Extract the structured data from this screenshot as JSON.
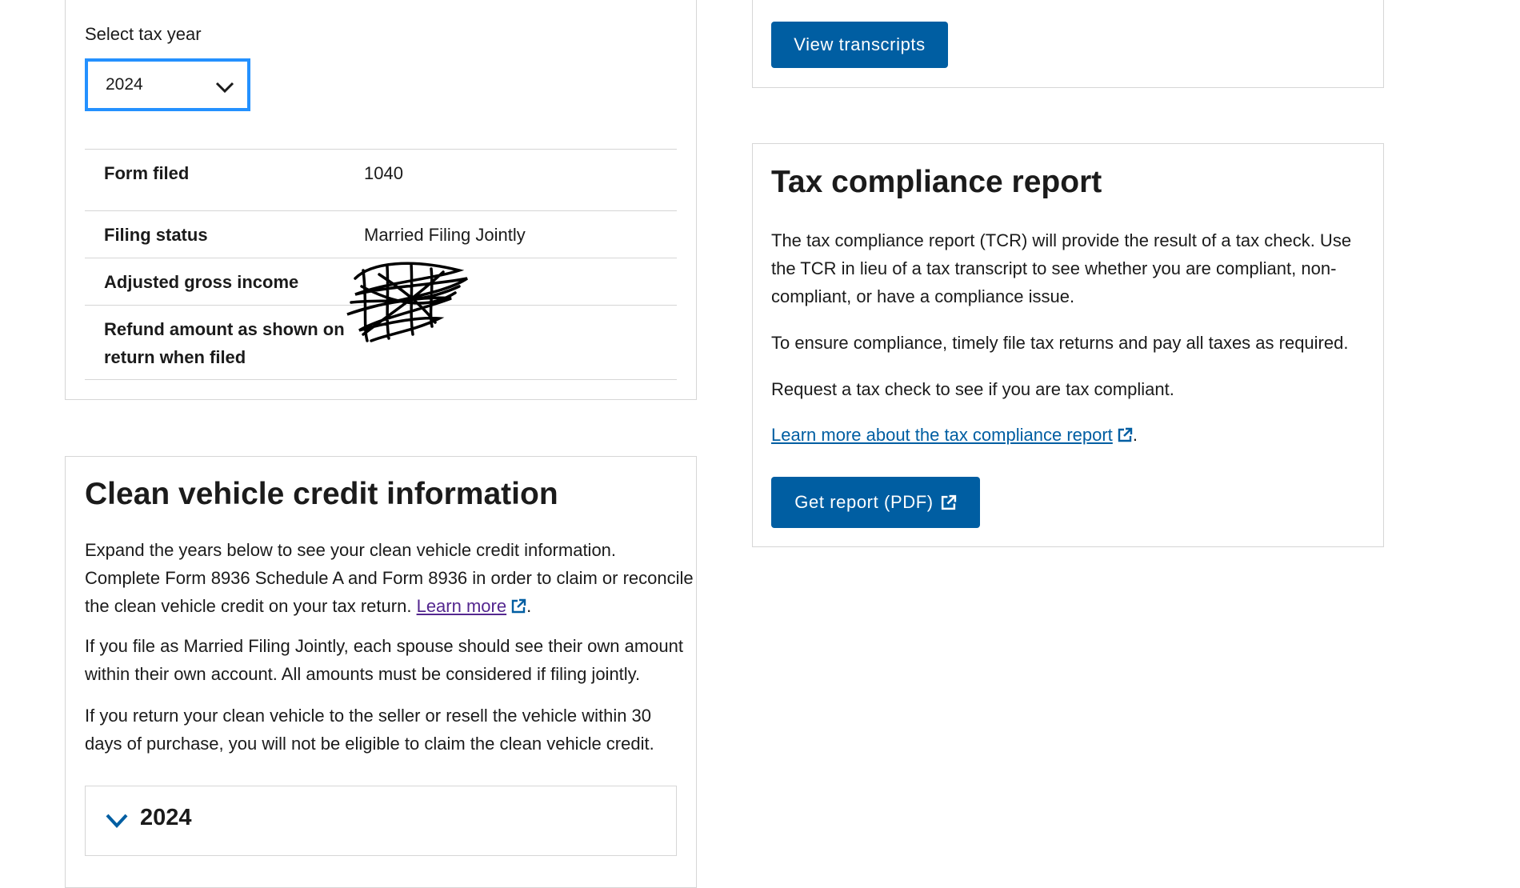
{
  "return_card": {
    "select_label": "Select tax year",
    "selected_year": "2024",
    "rows": [
      {
        "label": "Form filed",
        "value": "1040"
      },
      {
        "label": "Filing status",
        "value": "Married Filing Jointly"
      },
      {
        "label": "Adjusted gross income",
        "value": ""
      },
      {
        "label_line1": "Refund amount as shown on",
        "label_line2": "return when filed",
        "value": ""
      }
    ]
  },
  "transcripts_card": {
    "button_label": "View transcripts"
  },
  "tcr_card": {
    "title": "Tax compliance report",
    "para1_lines": [
      "The tax compliance report (TCR) will provide the result of a tax check. Use",
      "the TCR in lieu of a tax transcript to see whether you are compliant, non-",
      "compliant, or have a compliance issue."
    ],
    "para2": "To ensure compliance, timely file tax returns and pay all taxes as required.",
    "para3": "Request a tax check to see if you are tax compliant.",
    "learn_more_link": "Learn more about the tax compliance report",
    "button_label": "Get report (PDF)"
  },
  "cvc_card": {
    "title": "Clean vehicle credit information",
    "para1_lines": [
      "Expand the years below to see your clean vehicle credit information.",
      "Complete Form 8936 Schedule A and Form 8936 in order to claim or reconcile",
      "the clean vehicle credit on your tax return."
    ],
    "learn_more_link": "Learn more",
    "para2_lines": [
      "If you file as Married Filing Jointly, each spouse should see their own amount",
      "within their own account. All amounts must be considered if filing jointly."
    ],
    "para3_lines": [
      "If you return your clean vehicle to the seller or resell the vehicle within 30",
      "days of purchase, you will not be eligible to claim the clean vehicle credit."
    ],
    "accordion_year": "2024"
  },
  "colors": {
    "primary_button": "#005ea2",
    "focus_outline": "#2491ff",
    "visited_link": "#54278f",
    "border": "#d6d6d6"
  }
}
